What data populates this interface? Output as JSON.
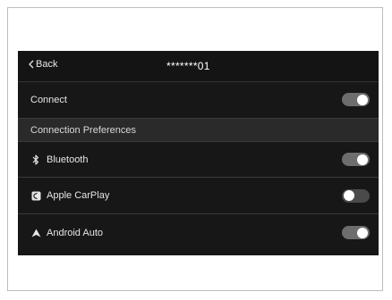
{
  "header": {
    "back_label": "Back",
    "title": "*******01"
  },
  "connect": {
    "label": "Connect",
    "state": "on"
  },
  "section": {
    "title": "Connection Preferences"
  },
  "preferences": [
    {
      "label": "Bluetooth",
      "icon": "bluetooth-icon",
      "state": "on"
    },
    {
      "label": "Apple CarPlay",
      "icon": "carplay-icon",
      "state": "off"
    },
    {
      "label": "Android Auto",
      "icon": "android-auto-icon",
      "state": "on"
    }
  ],
  "colors": {
    "screen_bg": "#171717",
    "section_bg": "#2a2a2a",
    "toggle_on": "#6d6d6d",
    "toggle_off": "#4a4a4a",
    "knob": "#ffffff"
  }
}
